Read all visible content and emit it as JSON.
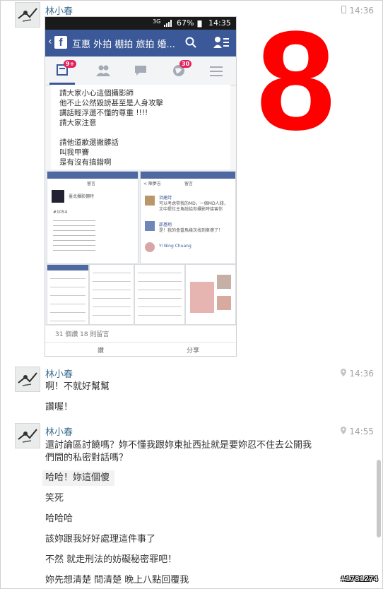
{
  "messages": [
    {
      "sender": "林小春",
      "time": "14:36",
      "time_icon": "phone-icon",
      "attachment": {
        "status_bar": {
          "signal": "3G",
          "battery": "67%",
          "clock": "14:35"
        },
        "fb_title": "互惠 外拍 棚拍 旅拍 婚...",
        "tabs": [
          {
            "icon": "news-feed-icon",
            "badge": "9+"
          },
          {
            "icon": "friends-icon",
            "badge": ""
          },
          {
            "icon": "messages-icon",
            "badge": ""
          },
          {
            "icon": "globe-notifications-icon",
            "badge": "30"
          },
          {
            "icon": "menu-icon",
            "badge": ""
          }
        ],
        "post_lines": [
          "請大家小心這個攝影師",
          "他不止公然毀謗甚至是人身攻擊",
          "講話輕浮還不懂的尊重 !!!!",
          "請大家注意",
          "",
          "請他道歉還撇髒話",
          "叫我甲賽",
          "是有沒有搞錯啊"
        ],
        "collage": {
          "left_header": "留言",
          "left_name": "臺北攝影棚特",
          "left_number": "#1054",
          "right_back": "< 陳夢吉",
          "right_header": "留言",
          "commenters": [
            "洪建詩",
            "邵基翔",
            "Yi Ning Chuang"
          ],
          "comment_lines": [
            "可以考虑带我的MD，一個MD人錢，",
            "文中提位主角說給你攝影時接害你",
            "是！我的會當馬幾次找到車擦了！"
          ]
        },
        "reactions": "31 個讚  18 則留言",
        "actions": [
          "讚",
          "分享"
        ]
      }
    },
    {
      "sender": "林小春",
      "time": "14:36",
      "time_icon": "location-pin-icon",
      "lines": [
        "啊！不就好幫幫",
        "讚喔！"
      ]
    },
    {
      "sender": "林小春",
      "time": "14:55",
      "time_icon": "location-pin-icon",
      "lines": [
        "還討論區討饒嗎？妳不懂我跟妳東扯西扯就是要妳忍不住去公開我",
        "們間的私密對話嗎？",
        "哈哈！妳這個傻",
        "笑死",
        "哈哈哈",
        "該妳跟我好好處理這件事了",
        "不然 就走刑法的妨礙秘密罪吧！",
        "妳先想清楚 問清楚 晚上八點回覆我"
      ]
    }
  ],
  "overlay_number": "8",
  "overlay_color": "#ff0000",
  "watermark": "#1781274",
  "colors": {
    "sender": "#3b6c8f",
    "facebook": "#3b5998",
    "badge": "#e0245e"
  }
}
